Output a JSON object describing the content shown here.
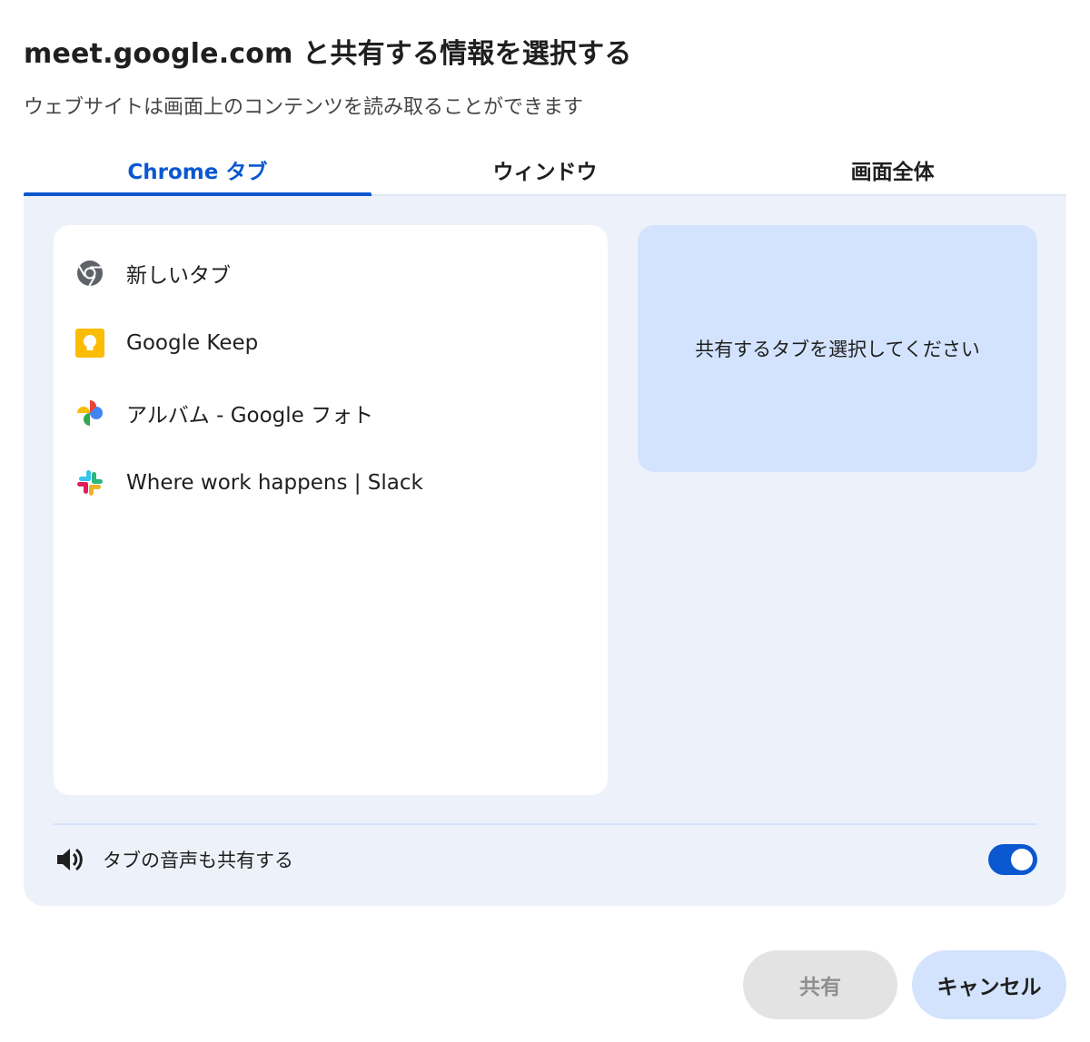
{
  "dialog": {
    "title": "meet.google.com と共有する情報を選択する",
    "subtitle": "ウェブサイトは画面上のコンテンツを読み取ることができます"
  },
  "tabs": [
    {
      "label": "Chrome タブ",
      "active": true
    },
    {
      "label": "ウィンドウ",
      "active": false
    },
    {
      "label": "画面全体",
      "active": false
    }
  ],
  "tab_list": [
    {
      "label": "新しいタブ",
      "icon": "chrome-icon"
    },
    {
      "label": "Google Keep",
      "icon": "google-keep-icon"
    },
    {
      "label": "アルバム - Google フォト",
      "icon": "google-photos-icon"
    },
    {
      "label": "Where work happens | Slack",
      "icon": "slack-icon"
    }
  ],
  "preview": {
    "placeholder": "共有するタブを選択してください"
  },
  "audio": {
    "label": "タブの音声も共有する",
    "icon": "speaker-icon",
    "enabled": true
  },
  "buttons": {
    "share": "共有",
    "cancel": "キャンセル"
  },
  "colors": {
    "accent": "#0b57d0",
    "panel_bg": "#edf2fa",
    "preview_bg": "#d3e3fd",
    "disabled_bg": "#e3e3e3"
  }
}
